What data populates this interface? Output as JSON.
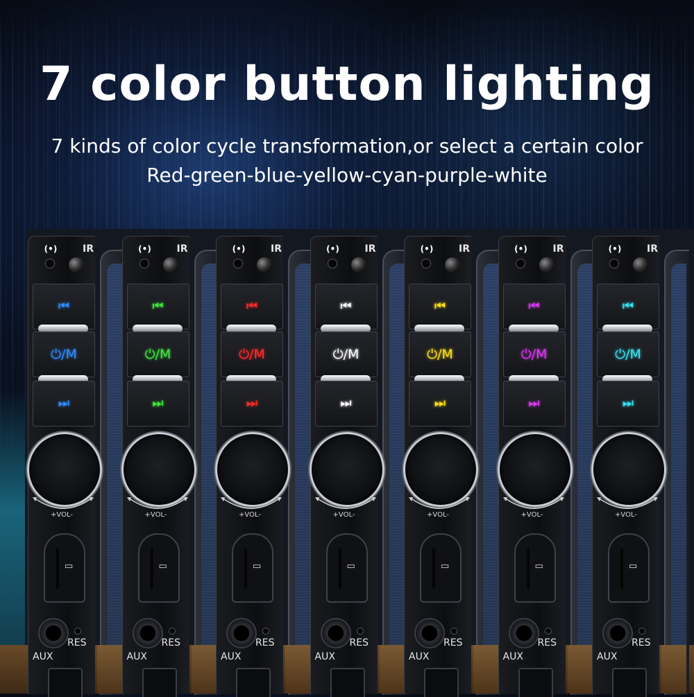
{
  "headline": {
    "title": "7 color button lighting",
    "subtitle_line1": "7 kinds of color cycle transformation,or select a certain color",
    "subtitle_line2": "Red-green-blue-yellow-cyan-purple-white"
  },
  "panel_labels": {
    "ir": "IR",
    "mode": "⏻/M",
    "volume": "+VOL-",
    "res": "RES",
    "aux": "AUX",
    "prev_glyph": "⏮",
    "next_glyph": "⏭"
  },
  "panels": [
    {
      "color": "#2f8cff"
    },
    {
      "color": "#3ee63e"
    },
    {
      "color": "#ff2a2a"
    },
    {
      "color": "#ffffff"
    },
    {
      "color": "#ffe11a"
    },
    {
      "color": "#d93bf0"
    },
    {
      "color": "#37e2f0"
    }
  ],
  "icons": {
    "signal": "signal-icon",
    "prev": "previous-track-icon",
    "next": "next-track-icon",
    "sd": "sd-card-icon"
  }
}
